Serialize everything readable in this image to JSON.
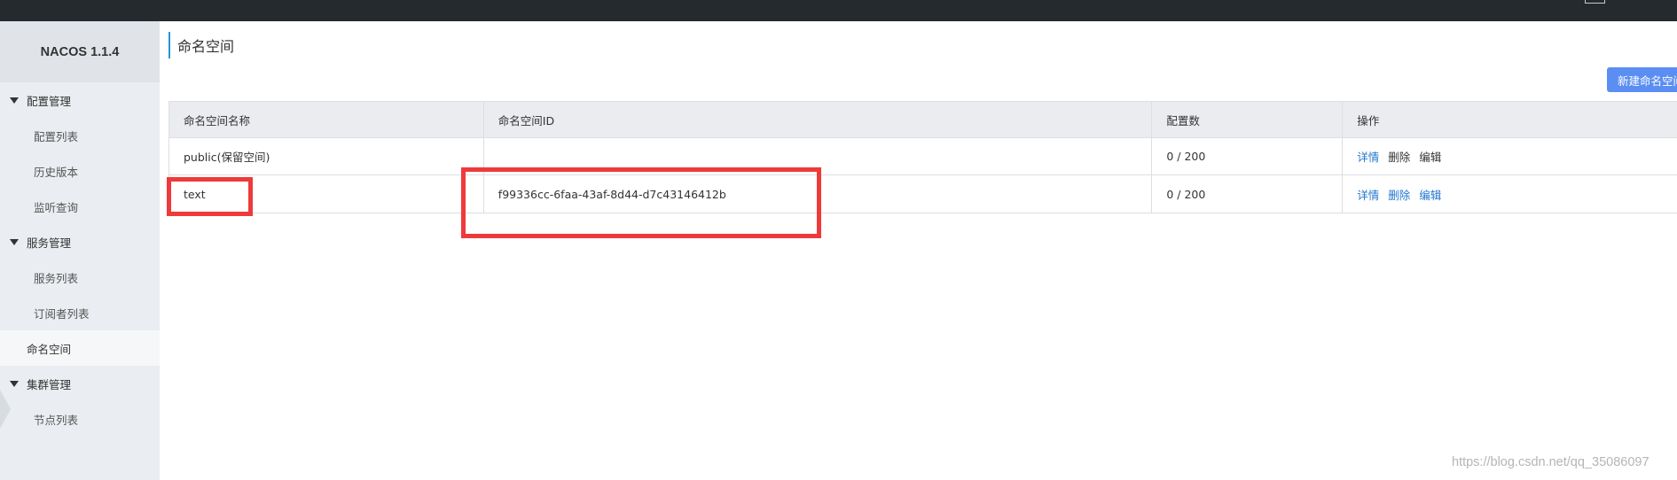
{
  "brand": "NACOS 1.1.4",
  "sidebar": {
    "groups": [
      {
        "label": "配置管理",
        "items": [
          "配置列表",
          "历史版本",
          "监听查询"
        ]
      },
      {
        "label": "服务管理",
        "items": [
          "服务列表",
          "订阅者列表"
        ]
      },
      {
        "label": "集群管理",
        "items": [
          "节点列表"
        ]
      }
    ],
    "active_item": "命名空间"
  },
  "page": {
    "title": "命名空间",
    "new_button": "新建命名空间"
  },
  "table": {
    "headers": [
      "命名空间名称",
      "命名空间ID",
      "配置数",
      "操作"
    ],
    "rows": [
      {
        "name": "public(保留空间)",
        "id": "",
        "count": "0 / 200",
        "actions": [
          "详情",
          "删除",
          "编辑"
        ]
      },
      {
        "name": "text",
        "id": "f99336cc-6faa-43af-8d44-d7c43146412b",
        "count": "0 / 200",
        "actions": [
          "详情",
          "删除",
          "编辑"
        ]
      }
    ]
  },
  "colors": {
    "highlight": "#ee3a3a",
    "primary": "#5b8ef2",
    "link": "#2176d0",
    "topbar": "#252a2f"
  },
  "watermark": "https://blog.csdn.net/qq_35086097"
}
